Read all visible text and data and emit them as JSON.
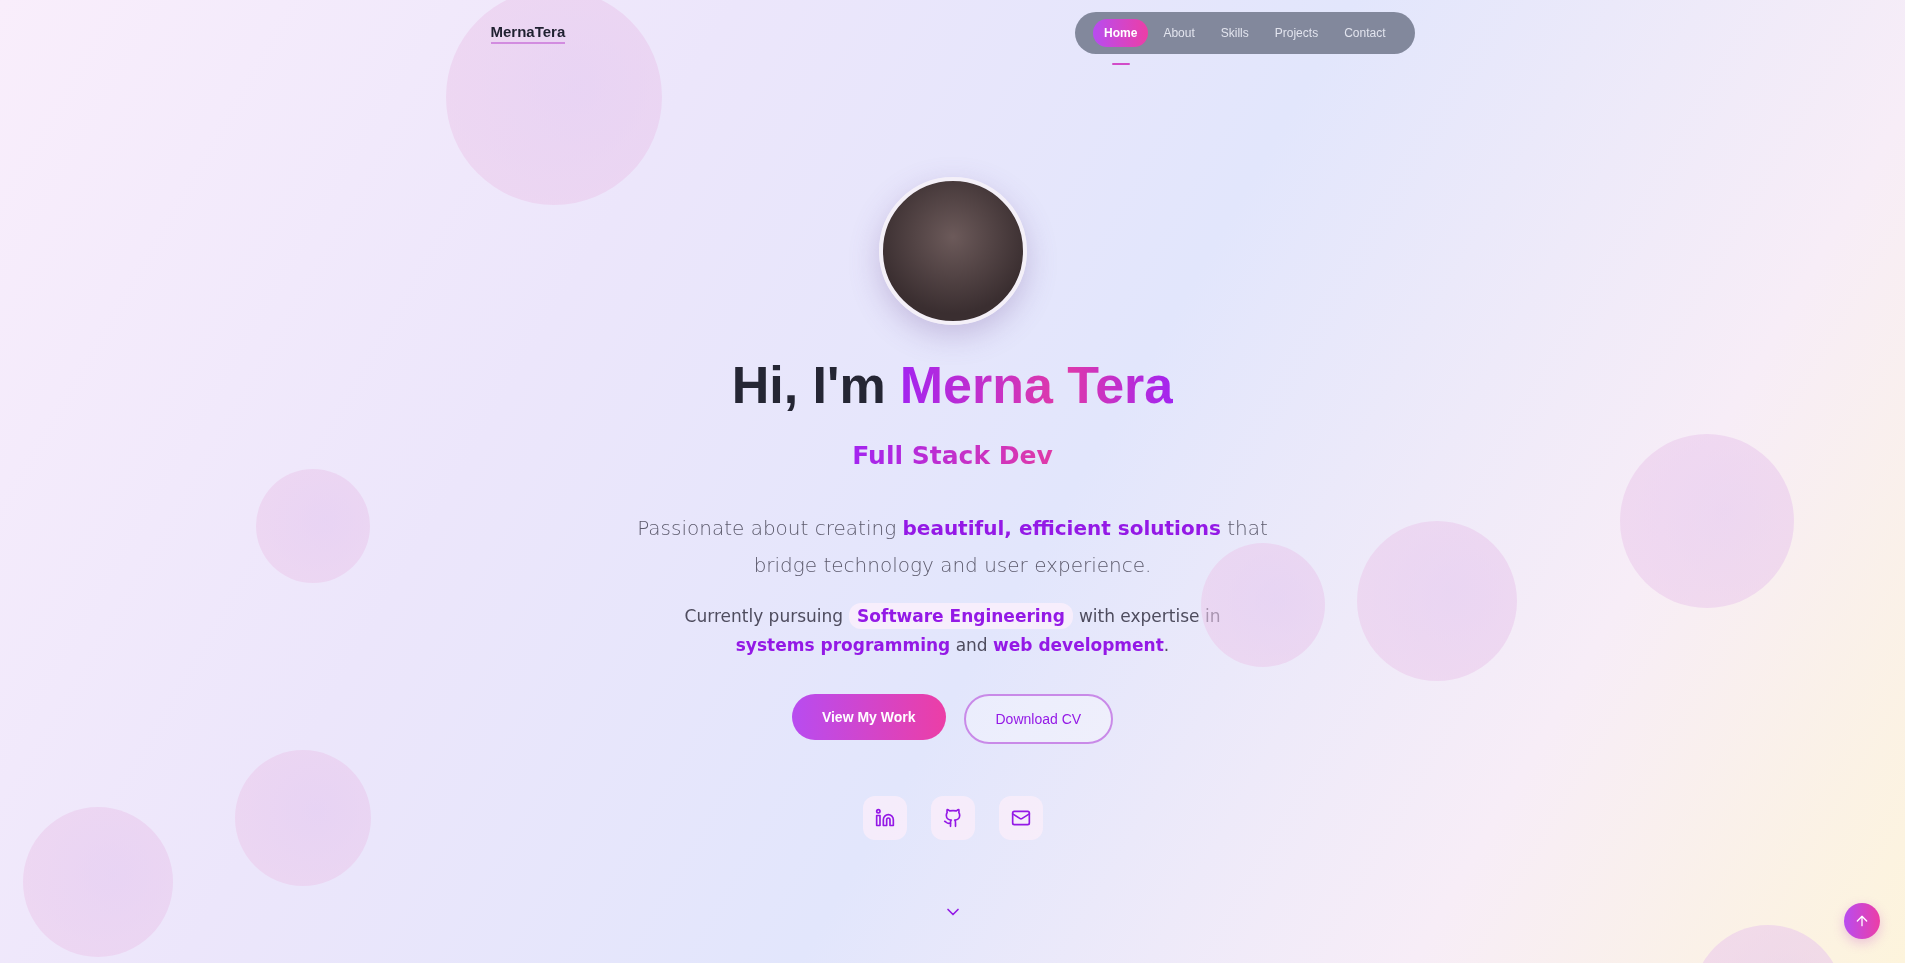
{
  "logo": "MernaTera",
  "nav": [
    {
      "label": "Home",
      "selected": true
    },
    {
      "label": "About",
      "selected": false
    },
    {
      "label": "Skills",
      "selected": false
    },
    {
      "label": "Projects",
      "selected": false
    },
    {
      "label": "Contact",
      "selected": false
    }
  ],
  "hero": {
    "greeting": "Hi, I'm",
    "name": "Merna Tera",
    "role": "Full Stack Dev",
    "intro": "Passionate about creating **beautiful, efficient solutions** that bridge technology and user experience.",
    "detail_before": "Currently pursuing",
    "detail_badge": "Software Engineering",
    "detail_after": "with expertise in **systems programming** and **web development**."
  },
  "buttons": [
    {
      "label": "View My Work",
      "kind": "primary"
    },
    {
      "label": "Download CV",
      "kind": "outline"
    }
  ]
}
